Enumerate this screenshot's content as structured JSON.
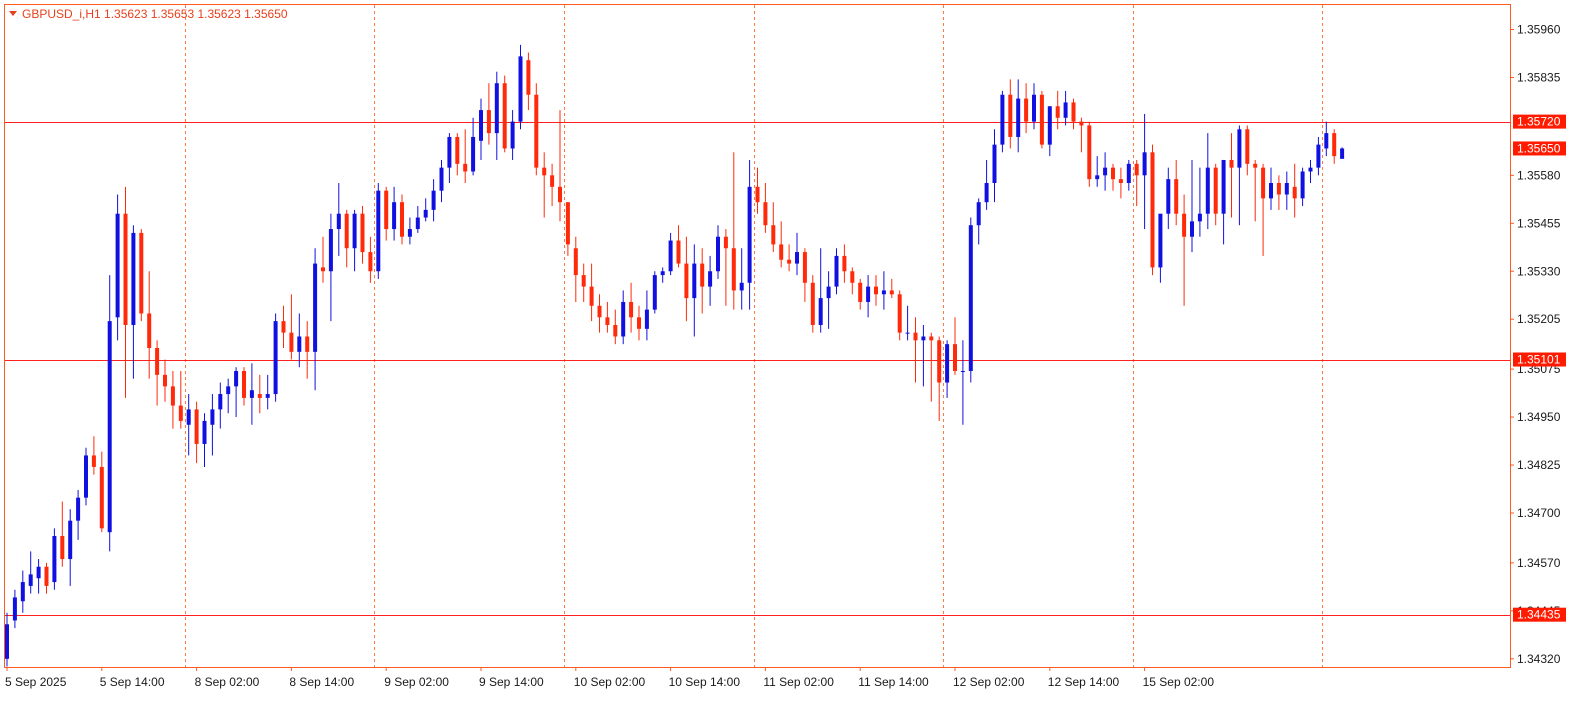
{
  "colors": {
    "frame": "#ff5a1f",
    "grid": "#ff7a3d",
    "bull": "#1010e0",
    "bear": "#ff2a0a",
    "hline": "#ff2020",
    "tag": "#ff1a00",
    "title": "#e8401c"
  },
  "chart_data": {
    "type": "candlestick",
    "title": "GBPUSD_i,H1  1.35623 1.35653 1.35623 1.35650",
    "symbol": "GBPUSD_i,H1",
    "last_ohlc": {
      "open": 1.35623,
      "high": 1.35653,
      "low": 1.35623,
      "close": 1.3565
    },
    "ylim": [
      1.3427,
      1.3599
    ],
    "y_ticks": [
      "1.35960",
      "1.35835",
      "1.35580",
      "1.35455",
      "1.35330",
      "1.35205",
      "1.35075",
      "1.34950",
      "1.34825",
      "1.34700",
      "1.34570",
      "1.34445",
      "1.34320"
    ],
    "x_ticks": [
      {
        "index": 0,
        "label": "5 Sep 2025"
      },
      {
        "index": 12,
        "label": "5 Sep 14:00"
      },
      {
        "index": 24,
        "label": "8 Sep 02:00"
      },
      {
        "index": 36,
        "label": "8 Sep 14:00"
      },
      {
        "index": 48,
        "label": "9 Sep 02:00"
      },
      {
        "index": 60,
        "label": "9 Sep 14:00"
      },
      {
        "index": 72,
        "label": "10 Sep 02:00"
      },
      {
        "index": 84,
        "label": "10 Sep 14:00"
      },
      {
        "index": 96,
        "label": "11 Sep 02:00"
      },
      {
        "index": 108,
        "label": "11 Sep 14:00"
      },
      {
        "index": 120,
        "label": "12 Sep 02:00"
      },
      {
        "index": 132,
        "label": "12 Sep 14:00"
      },
      {
        "index": 144,
        "label": "15 Sep 02:00"
      }
    ],
    "vgrid_index": [
      22,
      46,
      70,
      94,
      118,
      142,
      166
    ],
    "horizontal_lines": [
      {
        "price": 1.3572,
        "label": "1.35720"
      },
      {
        "price": 1.351,
        "label": "1.35101"
      },
      {
        "price": 1.34435,
        "label": "1.34435"
      }
    ],
    "current_price": {
      "price": 1.3565,
      "label": "1.35650"
    },
    "candles": [
      [
        1.3432,
        1.3444,
        1.343,
        1.3441
      ],
      [
        1.3442,
        1.345,
        1.344,
        1.3448
      ],
      [
        1.3447,
        1.3455,
        1.3444,
        1.3452
      ],
      [
        1.3451,
        1.346,
        1.3449,
        1.3454
      ],
      [
        1.3453,
        1.3458,
        1.3449,
        1.3456
      ],
      [
        1.3456,
        1.3457,
        1.3449,
        1.3451
      ],
      [
        1.3452,
        1.3466,
        1.345,
        1.3464
      ],
      [
        1.3464,
        1.3473,
        1.3456,
        1.3458
      ],
      [
        1.3458,
        1.3471,
        1.3451,
        1.3468
      ],
      [
        1.3468,
        1.3476,
        1.3463,
        1.3474
      ],
      [
        1.3474,
        1.3487,
        1.3472,
        1.3485
      ],
      [
        1.3485,
        1.349,
        1.348,
        1.3482
      ],
      [
        1.3482,
        1.3486,
        1.3465,
        1.3466
      ],
      [
        1.3465,
        1.3532,
        1.346,
        1.352
      ],
      [
        1.3521,
        1.3553,
        1.3515,
        1.3548
      ],
      [
        1.3548,
        1.3555,
        1.35,
        1.3519
      ],
      [
        1.3519,
        1.3545,
        1.3505,
        1.3543
      ],
      [
        1.3543,
        1.3544,
        1.352,
        1.3522
      ],
      [
        1.3522,
        1.3533,
        1.3505,
        1.3513
      ],
      [
        1.3513,
        1.3515,
        1.3498,
        1.3506
      ],
      [
        1.3506,
        1.351,
        1.3499,
        1.3503
      ],
      [
        1.3503,
        1.3507,
        1.3492,
        1.3498
      ],
      [
        1.3498,
        1.3507,
        1.3492,
        1.3494
      ],
      [
        1.3493,
        1.3501,
        1.3485,
        1.3497
      ],
      [
        1.3497,
        1.3499,
        1.3483,
        1.3488
      ],
      [
        1.3488,
        1.3496,
        1.3482,
        1.3494
      ],
      [
        1.3493,
        1.3501,
        1.3485,
        1.3497
      ],
      [
        1.3497,
        1.3504,
        1.3492,
        1.3501
      ],
      [
        1.3501,
        1.3505,
        1.3496,
        1.3503
      ],
      [
        1.3503,
        1.3508,
        1.3495,
        1.3507
      ],
      [
        1.3507,
        1.3508,
        1.3498,
        1.35
      ],
      [
        1.35,
        1.3509,
        1.3493,
        1.3502
      ],
      [
        1.3501,
        1.3506,
        1.3496,
        1.35
      ],
      [
        1.35,
        1.3506,
        1.3497,
        1.3501
      ],
      [
        1.3501,
        1.3522,
        1.3499,
        1.352
      ],
      [
        1.352,
        1.3524,
        1.3513,
        1.3517
      ],
      [
        1.3517,
        1.3527,
        1.351,
        1.3512
      ],
      [
        1.3512,
        1.3522,
        1.3508,
        1.3516
      ],
      [
        1.3516,
        1.352,
        1.3505,
        1.3512
      ],
      [
        1.3512,
        1.3539,
        1.3502,
        1.3535
      ],
      [
        1.3534,
        1.3542,
        1.353,
        1.3533
      ],
      [
        1.3533,
        1.3548,
        1.352,
        1.3544
      ],
      [
        1.3544,
        1.3556,
        1.3537,
        1.3548
      ],
      [
        1.3548,
        1.3549,
        1.3534,
        1.3539
      ],
      [
        1.3539,
        1.3549,
        1.3533,
        1.3548
      ],
      [
        1.3548,
        1.355,
        1.3535,
        1.3538
      ],
      [
        1.3538,
        1.3542,
        1.353,
        1.3533
      ],
      [
        1.3533,
        1.3556,
        1.3531,
        1.3554
      ],
      [
        1.3554,
        1.3555,
        1.3541,
        1.3544
      ],
      [
        1.3544,
        1.3555,
        1.3541,
        1.3551
      ],
      [
        1.3551,
        1.3553,
        1.354,
        1.3542
      ],
      [
        1.3542,
        1.3547,
        1.354,
        1.3544
      ],
      [
        1.3544,
        1.355,
        1.3543,
        1.3547
      ],
      [
        1.3547,
        1.3552,
        1.3546,
        1.3549
      ],
      [
        1.3549,
        1.3557,
        1.3546,
        1.3554
      ],
      [
        1.3554,
        1.3562,
        1.3551,
        1.356
      ],
      [
        1.356,
        1.3569,
        1.3556,
        1.3568
      ],
      [
        1.3568,
        1.3569,
        1.3558,
        1.3561
      ],
      [
        1.3561,
        1.357,
        1.3556,
        1.3559
      ],
      [
        1.3559,
        1.3573,
        1.3558,
        1.3568
      ],
      [
        1.3567,
        1.3578,
        1.3562,
        1.3575
      ],
      [
        1.3575,
        1.3582,
        1.3566,
        1.3569
      ],
      [
        1.3569,
        1.3585,
        1.3562,
        1.3582
      ],
      [
        1.3582,
        1.3584,
        1.3564,
        1.3565
      ],
      [
        1.3565,
        1.3575,
        1.3562,
        1.3572
      ],
      [
        1.3572,
        1.3592,
        1.357,
        1.3589
      ],
      [
        1.3588,
        1.359,
        1.3575,
        1.3579
      ],
      [
        1.3579,
        1.3582,
        1.3558,
        1.356
      ],
      [
        1.356,
        1.3564,
        1.3547,
        1.3558
      ],
      [
        1.3558,
        1.3561,
        1.355,
        1.3555
      ],
      [
        1.3555,
        1.3575,
        1.3546,
        1.3551
      ],
      [
        1.3551,
        1.3551,
        1.3537,
        1.354
      ],
      [
        1.3539,
        1.3542,
        1.3525,
        1.3532
      ],
      [
        1.3532,
        1.3535,
        1.3525,
        1.3529
      ],
      [
        1.3529,
        1.3535,
        1.352,
        1.3524
      ],
      [
        1.3524,
        1.3527,
        1.3517,
        1.3521
      ],
      [
        1.3521,
        1.3525,
        1.3517,
        1.3519
      ],
      [
        1.3519,
        1.3523,
        1.3514,
        1.3516
      ],
      [
        1.3516,
        1.3528,
        1.3514,
        1.3525
      ],
      [
        1.3525,
        1.353,
        1.3517,
        1.3521
      ],
      [
        1.3521,
        1.3524,
        1.3515,
        1.3518
      ],
      [
        1.3518,
        1.3528,
        1.3515,
        1.3523
      ],
      [
        1.3523,
        1.3533,
        1.3522,
        1.3532
      ],
      [
        1.3532,
        1.3534,
        1.353,
        1.3533
      ],
      [
        1.3533,
        1.3543,
        1.3532,
        1.3541
      ],
      [
        1.3541,
        1.3545,
        1.3534,
        1.3535
      ],
      [
        1.3535,
        1.3542,
        1.352,
        1.3526
      ],
      [
        1.3526,
        1.354,
        1.3516,
        1.3535
      ],
      [
        1.3535,
        1.3539,
        1.3522,
        1.3529
      ],
      [
        1.3529,
        1.3537,
        1.3524,
        1.3533
      ],
      [
        1.3533,
        1.3545,
        1.3531,
        1.3542
      ],
      [
        1.3542,
        1.3544,
        1.3524,
        1.3539
      ],
      [
        1.3539,
        1.3564,
        1.3523,
        1.3528
      ],
      [
        1.3528,
        1.3539,
        1.3523,
        1.353
      ],
      [
        1.353,
        1.3562,
        1.3523,
        1.3555
      ],
      [
        1.3555,
        1.356,
        1.3548,
        1.3551
      ],
      [
        1.3551,
        1.3556,
        1.3543,
        1.3545
      ],
      [
        1.3545,
        1.3551,
        1.3538,
        1.354
      ],
      [
        1.354,
        1.3546,
        1.3534,
        1.3536
      ],
      [
        1.3536,
        1.354,
        1.3533,
        1.3535
      ],
      [
        1.3535,
        1.3543,
        1.3532,
        1.3538
      ],
      [
        1.3538,
        1.3539,
        1.3525,
        1.353
      ],
      [
        1.353,
        1.3532,
        1.3517,
        1.3519
      ],
      [
        1.3519,
        1.3539,
        1.3517,
        1.3526
      ],
      [
        1.3526,
        1.3533,
        1.3518,
        1.3529
      ],
      [
        1.3529,
        1.3539,
        1.3527,
        1.3537
      ],
      [
        1.3537,
        1.354,
        1.353,
        1.3533
      ],
      [
        1.3533,
        1.3534,
        1.3527,
        1.353
      ],
      [
        1.353,
        1.3531,
        1.3523,
        1.3525
      ],
      [
        1.3525,
        1.3532,
        1.3521,
        1.3529
      ],
      [
        1.3529,
        1.3532,
        1.3524,
        1.3527
      ],
      [
        1.3527,
        1.3533,
        1.3523,
        1.3528
      ],
      [
        1.3528,
        1.3531,
        1.3526,
        1.3527
      ],
      [
        1.3527,
        1.3528,
        1.3515,
        1.3517
      ],
      [
        1.3517,
        1.3524,
        1.3515,
        1.3517
      ],
      [
        1.3517,
        1.3521,
        1.3504,
        1.3515
      ],
      [
        1.3515,
        1.3519,
        1.3503,
        1.3516
      ],
      [
        1.3516,
        1.3517,
        1.3499,
        1.3515
      ],
      [
        1.3515,
        1.3516,
        1.3494,
        1.3504
      ],
      [
        1.3504,
        1.3515,
        1.35,
        1.3514
      ],
      [
        1.3514,
        1.3521,
        1.3506,
        1.3507
      ],
      [
        1.3507,
        1.3515,
        1.3493,
        1.3507
      ],
      [
        1.3507,
        1.3547,
        1.3504,
        1.3545
      ],
      [
        1.3545,
        1.3552,
        1.354,
        1.3551
      ],
      [
        1.3551,
        1.3562,
        1.3549,
        1.3556
      ],
      [
        1.3556,
        1.357,
        1.3551,
        1.3566
      ],
      [
        1.3566,
        1.358,
        1.3564,
        1.3579
      ],
      [
        1.3579,
        1.3583,
        1.3565,
        1.3568
      ],
      [
        1.3568,
        1.3583,
        1.3564,
        1.3578
      ],
      [
        1.3578,
        1.3582,
        1.3569,
        1.3572
      ],
      [
        1.3572,
        1.3582,
        1.357,
        1.3579
      ],
      [
        1.3579,
        1.358,
        1.3565,
        1.3566
      ],
      [
        1.3566,
        1.3576,
        1.3563,
        1.3576
      ],
      [
        1.3576,
        1.358,
        1.357,
        1.3573
      ],
      [
        1.3573,
        1.358,
        1.3571,
        1.3577
      ],
      [
        1.3577,
        1.3578,
        1.357,
        1.3572
      ],
      [
        1.3572,
        1.3573,
        1.3564,
        1.3571
      ],
      [
        1.3571,
        1.3572,
        1.3555,
        1.3557
      ],
      [
        1.3557,
        1.3563,
        1.3555,
        1.3558
      ],
      [
        1.3558,
        1.3564,
        1.3554,
        1.356
      ],
      [
        1.356,
        1.3561,
        1.3554,
        1.3557
      ],
      [
        1.3557,
        1.356,
        1.3552,
        1.3556
      ],
      [
        1.3556,
        1.3562,
        1.3554,
        1.3561
      ],
      [
        1.3561,
        1.3562,
        1.355,
        1.3558
      ],
      [
        1.3558,
        1.3574,
        1.3544,
        1.3564
      ],
      [
        1.3564,
        1.3566,
        1.3532,
        1.3534
      ],
      [
        1.3534,
        1.354,
        1.353,
        1.3548
      ],
      [
        1.3548,
        1.356,
        1.3544,
        1.3557
      ],
      [
        1.3557,
        1.3562,
        1.3545,
        1.3548
      ],
      [
        1.3548,
        1.3553,
        1.3524,
        1.3542
      ],
      [
        1.3542,
        1.3562,
        1.3538,
        1.3546
      ],
      [
        1.3546,
        1.356,
        1.3542,
        1.3548
      ],
      [
        1.3548,
        1.3569,
        1.3544,
        1.356
      ],
      [
        1.356,
        1.3561,
        1.3545,
        1.3548
      ],
      [
        1.3548,
        1.3562,
        1.354,
        1.3562
      ],
      [
        1.3562,
        1.3569,
        1.3547,
        1.356
      ],
      [
        1.356,
        1.3571,
        1.3545,
        1.357
      ],
      [
        1.357,
        1.3571,
        1.3558,
        1.3561
      ],
      [
        1.3561,
        1.3562,
        1.3546,
        1.356
      ],
      [
        1.356,
        1.3561,
        1.3537,
        1.3552
      ],
      [
        1.3552,
        1.356,
        1.3549,
        1.3556
      ],
      [
        1.3556,
        1.3558,
        1.3549,
        1.3553
      ],
      [
        1.3553,
        1.3559,
        1.3549,
        1.3556
      ],
      [
        1.3555,
        1.3561,
        1.3547,
        1.3552
      ],
      [
        1.3552,
        1.356,
        1.355,
        1.3559
      ],
      [
        1.3559,
        1.3562,
        1.3556,
        1.356
      ],
      [
        1.356,
        1.3568,
        1.3558,
        1.3566
      ],
      [
        1.3565,
        1.3572,
        1.3563,
        1.3569
      ],
      [
        1.3569,
        1.357,
        1.3561,
        1.3563
      ],
      [
        1.35623,
        1.35653,
        1.35623,
        1.3565
      ]
    ]
  }
}
